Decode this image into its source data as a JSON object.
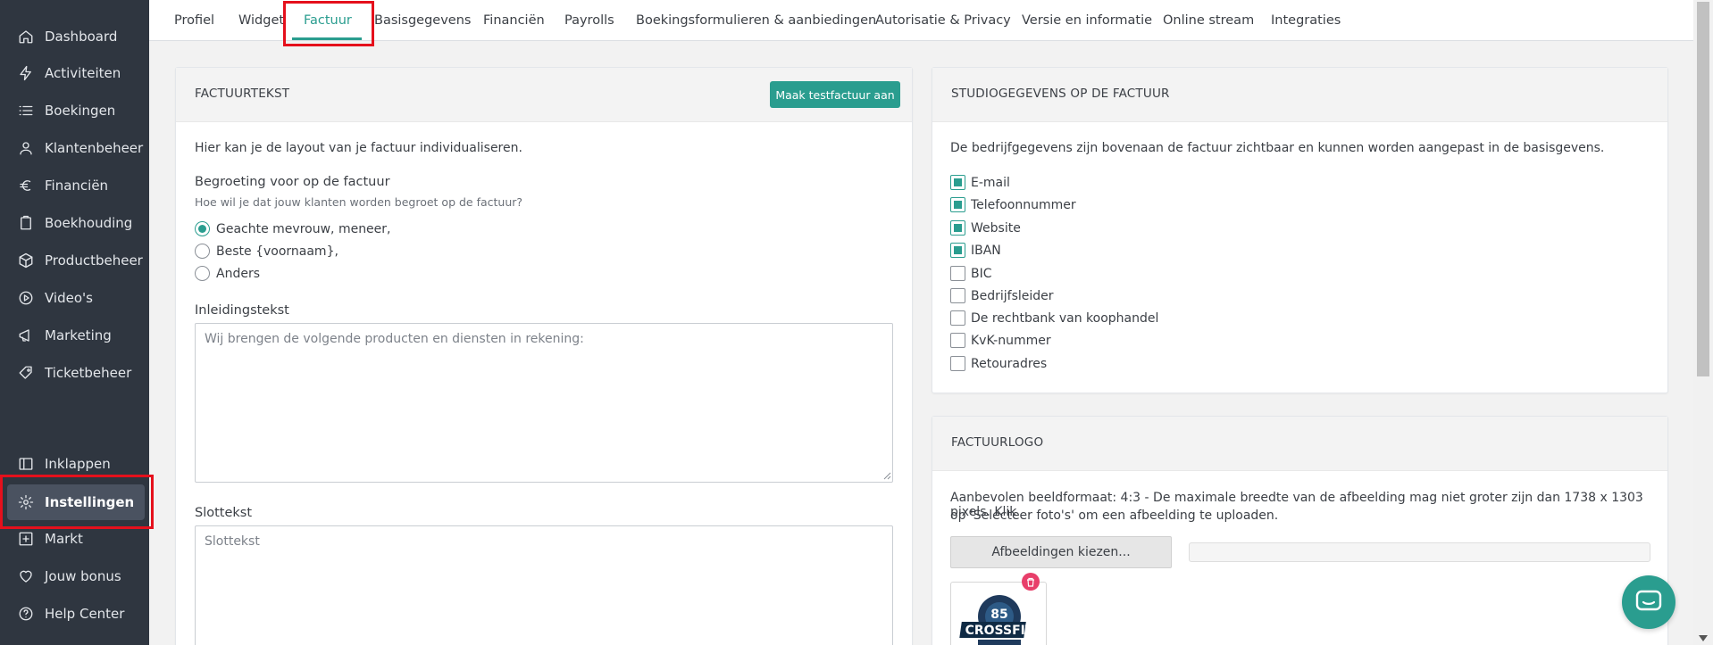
{
  "sidebar": {
    "items": [
      {
        "label": "Dashboard",
        "icon": "home-icon"
      },
      {
        "label": "Activiteiten",
        "icon": "activity-icon"
      },
      {
        "label": "Boekingen",
        "icon": "list-icon"
      },
      {
        "label": "Klantenbeheer",
        "icon": "user-icon"
      },
      {
        "label": "Financiën",
        "icon": "euro-icon"
      },
      {
        "label": "Boekhouding",
        "icon": "clipboard-icon"
      },
      {
        "label": "Productbeheer",
        "icon": "box-icon"
      },
      {
        "label": "Video's",
        "icon": "play-icon"
      },
      {
        "label": "Marketing",
        "icon": "megaphone-icon"
      },
      {
        "label": "Ticketbeheer",
        "icon": "tag-icon"
      }
    ],
    "bottom_items": [
      {
        "label": "Inklappen",
        "icon": "collapse-icon"
      },
      {
        "label": "Instellingen",
        "icon": "gear-icon",
        "active": true
      },
      {
        "label": "Markt",
        "icon": "plus-square-icon"
      },
      {
        "label": "Jouw bonus",
        "icon": "heart-icon"
      },
      {
        "label": "Help Center",
        "icon": "help-icon"
      }
    ]
  },
  "tabs": [
    {
      "label": "Profiel"
    },
    {
      "label": "Widget"
    },
    {
      "label": "Factuur",
      "active": true
    },
    {
      "label": "Basisgegevens"
    },
    {
      "label": "Financiën"
    },
    {
      "label": "Payrolls"
    },
    {
      "label": "Boekingsformulieren & aanbiedingen"
    },
    {
      "label": "Autorisatie & Privacy"
    },
    {
      "label": "Versie en informatie"
    },
    {
      "label": "Online stream"
    },
    {
      "label": "Integraties"
    }
  ],
  "invoice_text": {
    "title": "FACTUURTEKST",
    "test_button": "Maak testfactuur aan",
    "description": "Hier kan je de layout van je factuur individualiseren.",
    "greeting_label": "Begroeting voor op de factuur",
    "greeting_hint": "Hoe wil je dat jouw klanten worden begroet op de factuur?",
    "greeting_options": [
      {
        "label": "Geachte mevrouw, meneer,",
        "selected": true
      },
      {
        "label": "Beste {voornaam},",
        "selected": false
      },
      {
        "label": "Anders",
        "selected": false
      }
    ],
    "intro_label": "Inleidingstekst",
    "intro_placeholder": "Wij brengen de volgende producten en diensten in rekening:",
    "closing_label": "Slottekst",
    "closing_placeholder": "Slottekst"
  },
  "studio_details": {
    "title": "STUDIOGEGEVENS OP DE FACTUUR",
    "description": "De bedrijfgegevens zijn bovenaan de factuur zichtbaar en kunnen worden aangepast in de basisgevens.",
    "options": [
      {
        "label": "E-mail",
        "checked": true
      },
      {
        "label": "Telefoonnummer",
        "checked": true
      },
      {
        "label": "Website",
        "checked": true
      },
      {
        "label": "IBAN",
        "checked": true
      },
      {
        "label": "BIC",
        "checked": false
      },
      {
        "label": "Bedrijfsleider",
        "checked": false
      },
      {
        "label": "De rechtbank van koophandel",
        "checked": false
      },
      {
        "label": "KvK-nummer",
        "checked": false
      },
      {
        "label": "Retouradres",
        "checked": false
      }
    ]
  },
  "invoice_logo": {
    "title": "FACTUURLOGO",
    "description_line1": "Aanbevolen beeldformaat: 4:3 - De maximale breedte van de afbeelding mag niet groter zijn dan 1738 x 1303 pixels. Klik",
    "description_line2": "op 'Selecteer foto's' om een afbeelding te uploaden.",
    "choose_button": "Afbeeldingen kiezen...",
    "logo_text": "CROSSFIT",
    "logo_number": "85"
  },
  "colors": {
    "accent": "#2a9d8f",
    "sidebar_bg": "#2f3640",
    "highlight": "#e5101c",
    "delete": "#e83e6a"
  }
}
